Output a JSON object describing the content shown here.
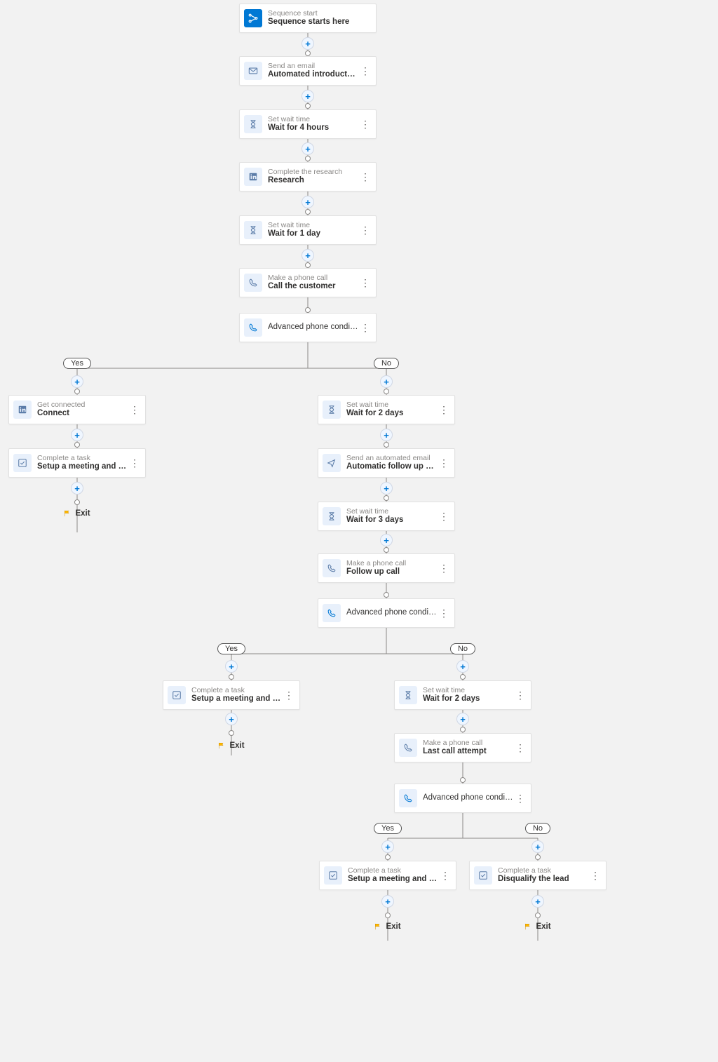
{
  "labels": {
    "yes": "Yes",
    "no": "No",
    "exit": "Exit"
  },
  "nodes": {
    "start": {
      "sub": "Sequence start",
      "main": "Sequence starts here"
    },
    "email1": {
      "sub": "Send an email",
      "main": "Automated introductory email"
    },
    "wait4h": {
      "sub": "Set wait time",
      "main": "Wait for 4 hours"
    },
    "research": {
      "sub": "Complete the research",
      "main": "Research"
    },
    "wait1d": {
      "sub": "Set wait time",
      "main": "Wait for 1 day"
    },
    "call1": {
      "sub": "Make a phone call",
      "main": "Call the customer"
    },
    "cond1": {
      "main": "Advanced phone condition"
    },
    "connect": {
      "sub": "Get connected",
      "main": "Connect"
    },
    "task_yes1": {
      "sub": "Complete a task",
      "main": "Setup a meeting and move to the next s..."
    },
    "wait2d": {
      "sub": "Set wait time",
      "main": "Wait for 2 days"
    },
    "email2": {
      "sub": "Send an automated email",
      "main": "Automatic follow up email"
    },
    "wait3d": {
      "sub": "Set wait time",
      "main": "Wait for 3 days"
    },
    "call2": {
      "sub": "Make a phone call",
      "main": "Follow up call"
    },
    "cond2": {
      "main": "Advanced phone condition"
    },
    "task_yes2": {
      "sub": "Complete a task",
      "main": "Setup a meeting and move to the next s..."
    },
    "wait2d_b": {
      "sub": "Set wait time",
      "main": "Wait for 2 days"
    },
    "call3": {
      "sub": "Make a phone call",
      "main": "Last call attempt"
    },
    "cond3": {
      "main": "Advanced phone condition"
    },
    "task_yes3": {
      "sub": "Complete a task",
      "main": "Setup a meeting and move to the next s..."
    },
    "task_no3": {
      "sub": "Complete a task",
      "main": "Disqualify the lead"
    }
  }
}
